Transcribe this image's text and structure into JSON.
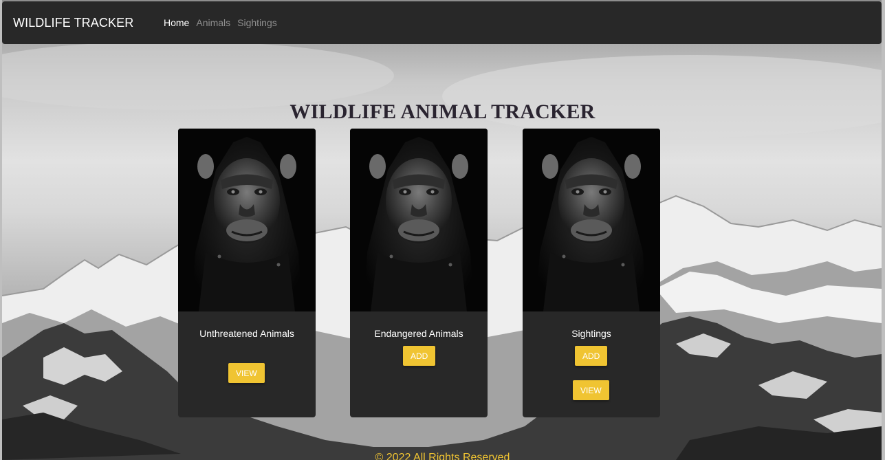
{
  "nav": {
    "brand": "WILDLIFE TRACKER",
    "links": [
      {
        "label": "Home",
        "active": true
      },
      {
        "label": "Animals",
        "active": false
      },
      {
        "label": "Sightings",
        "active": false
      }
    ]
  },
  "main": {
    "title": "WILDLIFE ANIMAL TRACKER",
    "cards": [
      {
        "image": "chimpanzee-portrait",
        "title": "Unthreatened Animals",
        "buttons": [
          "VIEW"
        ]
      },
      {
        "image": "chimpanzee-portrait",
        "title": "Endangered Animals",
        "buttons": [
          "ADD"
        ]
      },
      {
        "image": "chimpanzee-portrait",
        "title": "Sightings",
        "buttons": [
          "ADD",
          "VIEW"
        ]
      }
    ]
  },
  "footer": {
    "text": "© 2022 All Rights Reserved"
  },
  "colors": {
    "navbar": "#282828",
    "card": "#282828",
    "accent": "#f0c432",
    "title": "#2a2430"
  }
}
